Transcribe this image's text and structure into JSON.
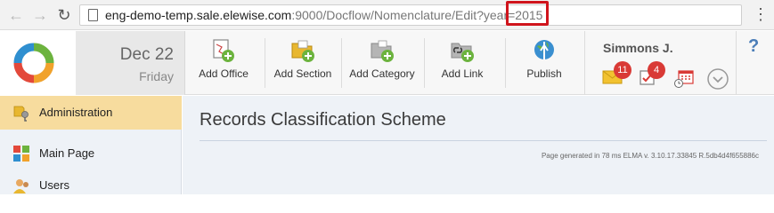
{
  "browser": {
    "url_host": "eng-demo-temp.sale.elewise.com",
    "url_path": ":9000/Docflow/Nomenclature/Edit?year=2015",
    "icons": [
      "back-arrow-icon",
      "forward-arrow-icon",
      "reload-icon",
      "page-icon",
      "menu-dots-icon"
    ],
    "highlight_color": "#d0141c"
  },
  "header": {
    "date": "Dec 22",
    "weekday": "Friday",
    "toolbar": {
      "add_office": "Add Office",
      "add_section": "Add Section",
      "add_category": "Add Category",
      "add_link": "Add Link",
      "publish": "Publish"
    },
    "user": {
      "name": "Simmons J.",
      "messages_count": "11",
      "tasks_count": "4"
    },
    "help": "?",
    "accent_colors": {
      "green": "#6cb33e",
      "badge": "#d93a36",
      "folder": "#e8b730"
    }
  },
  "sidebar": {
    "items": [
      {
        "label": "Administration",
        "icon": "admin-key-icon",
        "active": true
      },
      {
        "label": "Main Page",
        "icon": "main-page-grid-icon",
        "active": false
      },
      {
        "label": "Users",
        "icon": "users-icon",
        "active": false
      }
    ],
    "active_color": "#f7dc9e"
  },
  "main": {
    "title": "Records Classification Scheme",
    "generated": "Page generated in 78 ms ELMA v. 3.10.17.33845 R.5db4d4f655886c"
  }
}
